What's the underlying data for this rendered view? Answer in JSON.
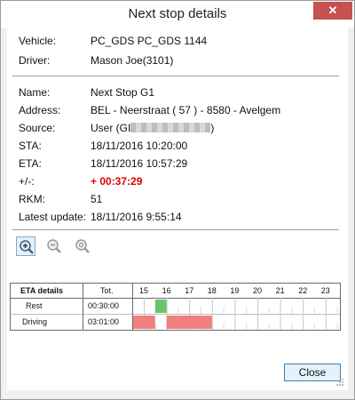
{
  "window": {
    "title": "Next stop details",
    "close_glyph": "✕"
  },
  "vehicle": {
    "label": "Vehicle:",
    "value": "PC_GDS PC_GDS 1144"
  },
  "driver": {
    "label": "Driver:",
    "value": "Mason Joe(3101)"
  },
  "stop": {
    "name_label": "Name:",
    "name": "Next Stop G1",
    "address_label": "Address:",
    "address": "BEL - Neerstraat ( 57 ) - 8580 - Avelgem",
    "source_label": "Source:",
    "source_prefix": "User (GI",
    "source_suffix": ")",
    "sta_label": "STA:",
    "sta": "18/11/2016 10:20:00",
    "eta_label": "ETA:",
    "eta": "18/11/2016 10:57:29",
    "delta_label": "+/-:",
    "delta": "+ 00:37:29",
    "rkm_label": "RKM:",
    "rkm": "51",
    "latest_label": "Latest update:",
    "latest": "18/11/2016 9:55:14"
  },
  "toolbar": {
    "zoom_in_icon": "zoom-in-icon",
    "zoom_out_icon": "zoom-out-icon",
    "zoom_fit_icon": "zoom-fit-icon"
  },
  "eta_table": {
    "header": "ETA details",
    "tot_header": "Tot.",
    "hours": [
      "15",
      "16",
      "17",
      "18",
      "19",
      "20",
      "21",
      "22",
      "23"
    ],
    "rows": [
      {
        "label": "Rest",
        "total": "00:30:00",
        "color": "#6cc36c"
      },
      {
        "label": "Driving",
        "total": "03:01:00",
        "color": "#f08080"
      }
    ]
  },
  "buttons": {
    "close": "Close"
  }
}
